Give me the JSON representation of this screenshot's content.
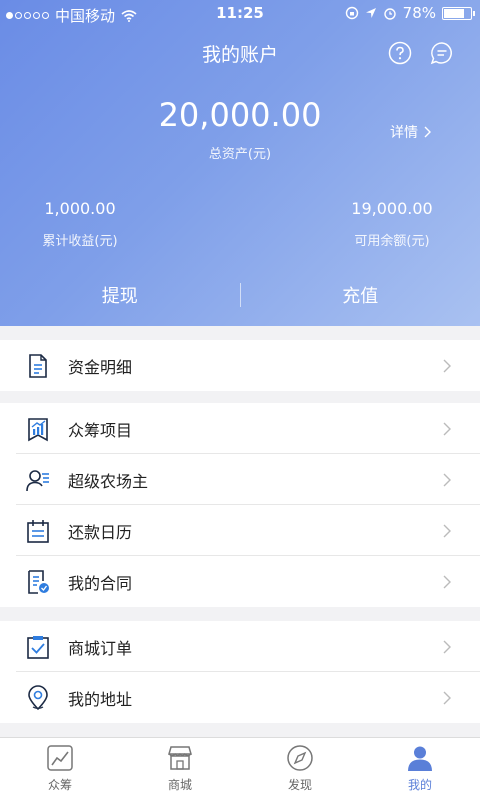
{
  "status_bar": {
    "carrier": "中国移动",
    "time": "11:25",
    "battery": "78%",
    "battery_level": 0.78
  },
  "header": {
    "title": "我的账户",
    "help_icon": "question-circle-icon",
    "message_icon": "chat-bubble-icon",
    "total_amount": "20,000.00",
    "total_label": "总资产(元)",
    "detail_label": "详情",
    "stats": [
      {
        "value": "1,000.00",
        "label": "累计收益(元)"
      },
      {
        "value": "19,000.00",
        "label": "可用余额(元)"
      }
    ],
    "withdraw_label": "提现",
    "recharge_label": "充值"
  },
  "menu": {
    "group1": [
      {
        "label": "资金明细",
        "icon": "document-list-icon"
      }
    ],
    "group2": [
      {
        "label": "众筹项目",
        "icon": "chart-bookmark-icon"
      },
      {
        "label": "超级农场主",
        "icon": "user-list-icon"
      },
      {
        "label": "还款日历",
        "icon": "calendar-icon"
      },
      {
        "label": "我的合同",
        "icon": "contract-icon"
      }
    ],
    "group3": [
      {
        "label": "商城订单",
        "icon": "clipboard-check-icon"
      },
      {
        "label": "我的地址",
        "icon": "location-pin-icon"
      }
    ]
  },
  "tabbar": {
    "tabs": [
      {
        "label": "众筹",
        "icon": "trend-chart-icon"
      },
      {
        "label": "商城",
        "icon": "store-icon"
      },
      {
        "label": "发现",
        "icon": "compass-icon"
      },
      {
        "label": "我的",
        "icon": "user-icon"
      }
    ],
    "active_color": "#5a7fd8"
  },
  "colors": {
    "header_start": "#6a8ce6",
    "header_end": "#a9c1f1",
    "icon_blue": "#2f7ddf",
    "background": "#f2f2f4"
  }
}
